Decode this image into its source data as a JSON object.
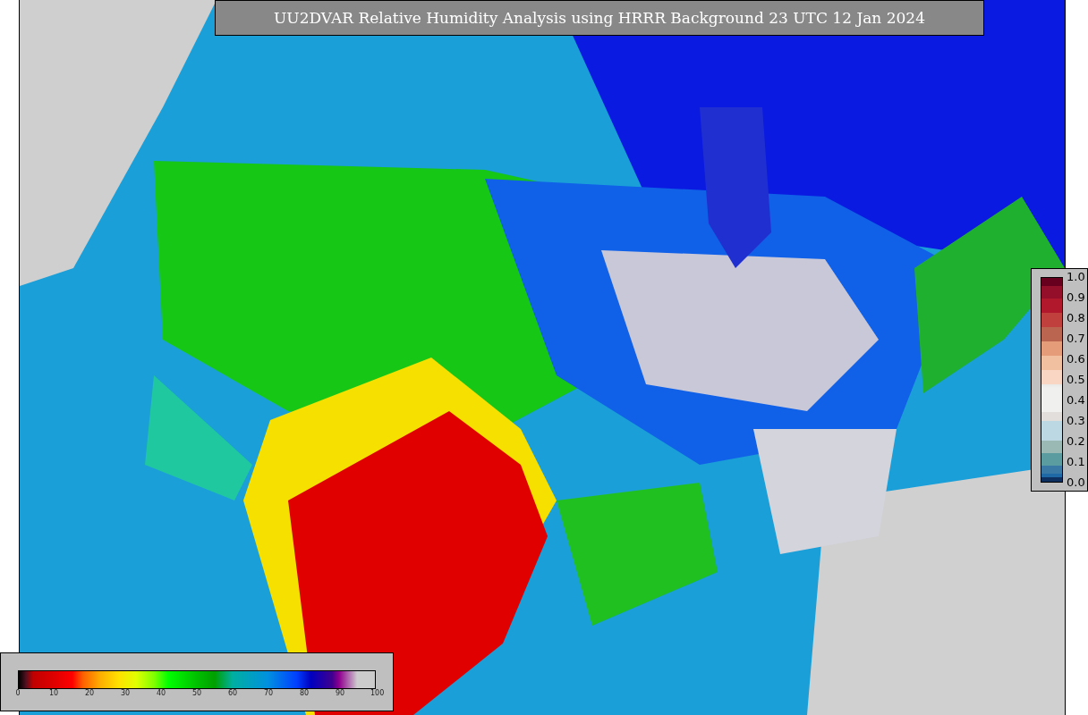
{
  "title": "UU2DVAR Relative Humidity Analysis using HRRR Background 23 UTC 12 Jan 2024",
  "ratio_colorbar": {
    "ticks": [
      "1.0",
      "0.9",
      "0.8",
      "0.7",
      "0.6",
      "0.5",
      "0.4",
      "0.3",
      "0.2",
      "0.1",
      "0.0"
    ]
  },
  "humidity_colorbar": {
    "ticks": [
      "0",
      "10",
      "20",
      "30",
      "40",
      "50",
      "60",
      "70",
      "80",
      "90",
      "100"
    ]
  }
}
